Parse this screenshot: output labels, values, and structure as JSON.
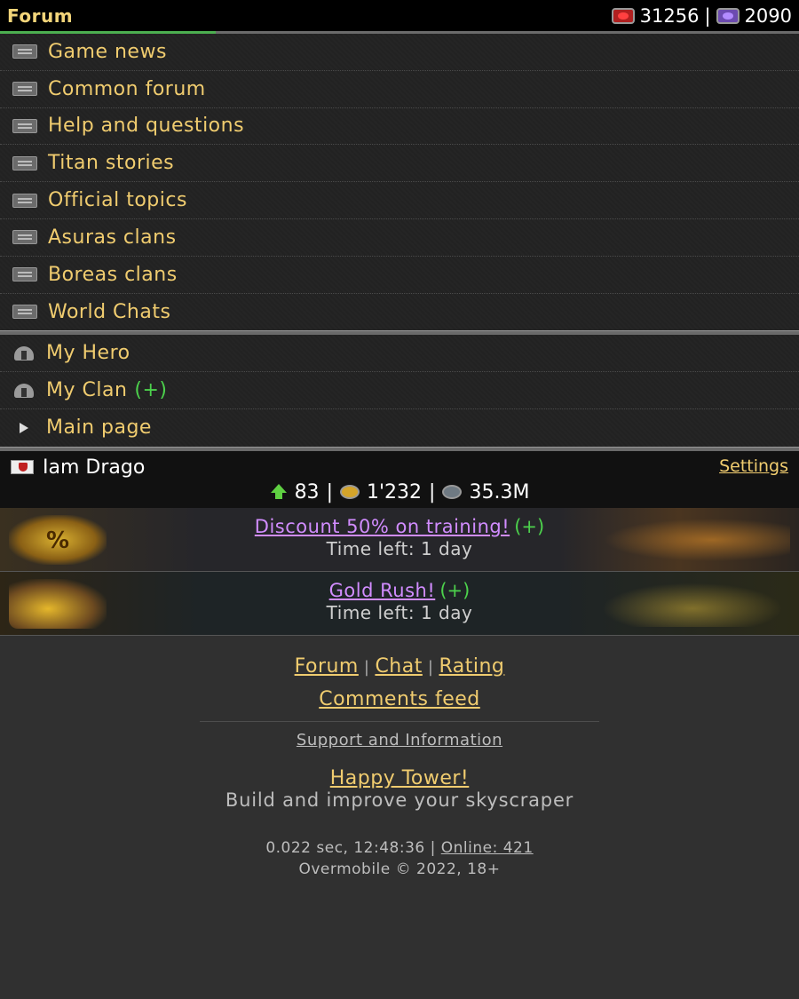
{
  "topbar": {
    "title": "Forum",
    "red_gems": "31256",
    "separator": "|",
    "purple_gems": "2090"
  },
  "menu": {
    "items": [
      {
        "label": "Game news",
        "icon": "document-icon"
      },
      {
        "label": "Common forum",
        "icon": "document-icon"
      },
      {
        "label": "Help and questions",
        "icon": "document-icon"
      },
      {
        "label": "Titan stories",
        "icon": "document-icon"
      },
      {
        "label": "Official topics",
        "icon": "document-icon"
      },
      {
        "label": "Asuras clans",
        "icon": "document-icon"
      },
      {
        "label": "Boreas clans",
        "icon": "document-icon"
      },
      {
        "label": "World Chats",
        "icon": "document-icon"
      }
    ],
    "secondary": [
      {
        "label": "My Hero",
        "icon": "helmet-icon"
      },
      {
        "label": "My Clan",
        "extra": "(+)",
        "icon": "helmet-icon"
      },
      {
        "label": "Main page",
        "icon": "arrow-icon"
      }
    ]
  },
  "hero": {
    "name": "Iam Drago",
    "settings": "Settings",
    "level": "83",
    "gold": "1'232",
    "iron": "35.3M",
    "sep": "|"
  },
  "banners": [
    {
      "link": "Discount 50% on training!",
      "plus": "(+)",
      "time": "Time left: 1 day",
      "icon_text": "%"
    },
    {
      "link": "Gold Rush!",
      "plus": "(+)",
      "time": "Time left: 1 day"
    }
  ],
  "footer": {
    "links": [
      "Forum",
      "Chat",
      "Rating"
    ],
    "bar": "|",
    "comments_feed": "Comments feed",
    "support": "Support and Information",
    "tower_link": "Happy Tower!",
    "tagline": "Build and improve your skyscraper",
    "meta_time": "0.022 sec, 12:48:36 |",
    "online": "Online: 421",
    "copyright": "Overmobile © 2022, 18+"
  },
  "colors": {
    "accent_gold": "#f0cc6f",
    "link_purple": "#d18cff",
    "plus_green": "#4cd14c",
    "progress_green": "#4caf50"
  }
}
